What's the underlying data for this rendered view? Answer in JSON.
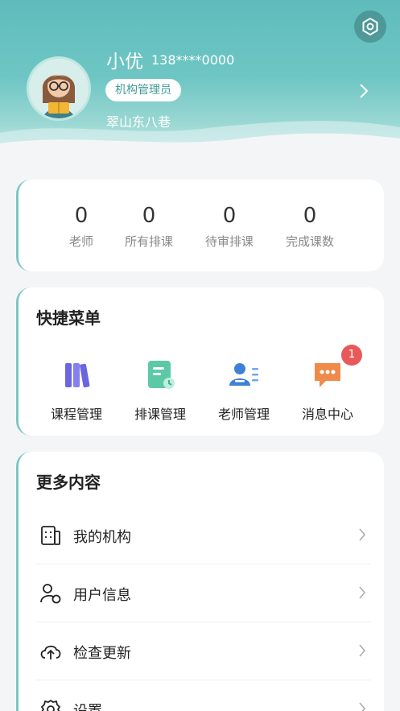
{
  "colors": {
    "accent": "#5fbcbc",
    "badge": "#e85a5a",
    "text": "#222222",
    "muted": "#888888"
  },
  "profile": {
    "name": "小优",
    "phone": "138****0000",
    "role": "机构管理员",
    "location": "翠山东八巷"
  },
  "stats": [
    {
      "value": "0",
      "label": "老师"
    },
    {
      "value": "0",
      "label": "所有排课"
    },
    {
      "value": "0",
      "label": "待审排课"
    },
    {
      "value": "0",
      "label": "完成课数"
    }
  ],
  "quick_menu": {
    "title": "快捷菜单",
    "items": [
      {
        "label": "课程管理",
        "icon": "books-icon"
      },
      {
        "label": "排课管理",
        "icon": "schedule-doc-icon"
      },
      {
        "label": "老师管理",
        "icon": "teacher-list-icon"
      },
      {
        "label": "消息中心",
        "icon": "chat-bubble-icon",
        "badge": "1"
      }
    ]
  },
  "more": {
    "title": "更多内容",
    "items": [
      {
        "label": "我的机构",
        "icon": "building-icon"
      },
      {
        "label": "用户信息",
        "icon": "user-icon"
      },
      {
        "label": "检查更新",
        "icon": "cloud-upload-icon"
      },
      {
        "label": "设置",
        "icon": "gear-icon"
      }
    ]
  }
}
